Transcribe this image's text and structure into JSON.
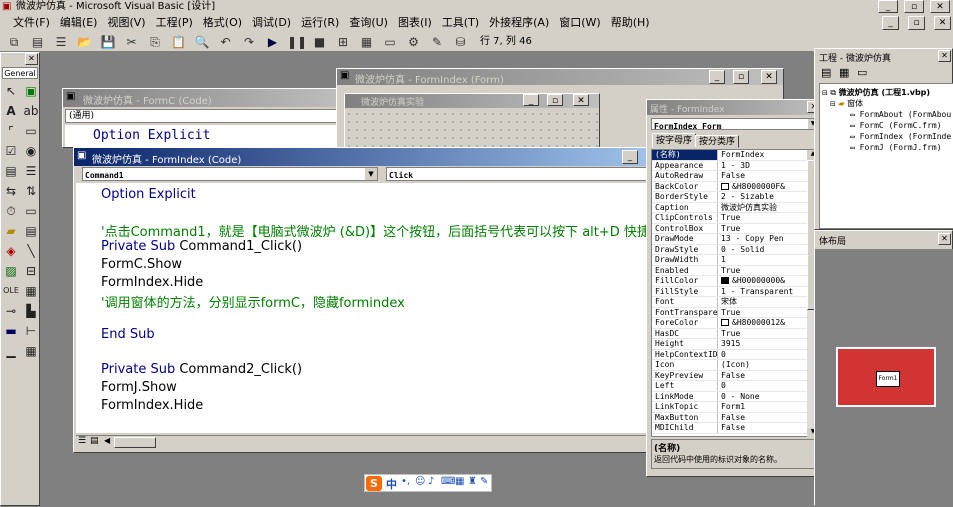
{
  "app_title": "微波炉仿真 - Microsoft Visual Basic [设计]",
  "menu": [
    "文件(F)",
    "编辑(E)",
    "视图(V)",
    "工程(P)",
    "格式(O)",
    "调试(D)",
    "运行(R)",
    "查询(U)",
    "图表(I)",
    "工具(T)",
    "外接程序(A)",
    "窗口(W)",
    "帮助(H)"
  ],
  "toolbar": {
    "position": "行 7, 列 46"
  },
  "toolbox": {
    "title": "General"
  },
  "windows": {
    "formc_code": {
      "title": "微波炉仿真 - FormC (Code)",
      "combo": "(通用)",
      "code_line": "Option Explicit"
    },
    "formindex_form": {
      "title": "微波炉仿真 - FormIndex (Form)"
    },
    "designer_inner": {
      "title": "微波炉仿真实验"
    },
    "formindex_code": {
      "title": "微波炉仿真 - FormIndex (Code)",
      "object_combo": "Command1",
      "proc_combo": "Click",
      "lines": [
        "Option Explicit",
        "",
        "'点击Command1，就是【电脑式微波炉 (&D)】这个按钮，后面括号代表可以按下 alt+D 快捷",
        "Private Sub Command1_Click()",
        "FormC.Show",
        "FormIndex.Hide",
        "'调用窗体的方法，分别显示formC，隐藏formindex",
        "",
        "End Sub",
        "",
        "Private Sub Command2_Click()",
        "FormJ.Show",
        "FormIndex.Hide"
      ]
    }
  },
  "properties": {
    "title": "属性 - FormIndex",
    "object": "FormIndex Form",
    "tabs": [
      "按字母序",
      "按分类序"
    ],
    "rows": [
      [
        "(名称)",
        "FormIndex"
      ],
      [
        "Appearance",
        "1 - 3D"
      ],
      [
        "AutoRedraw",
        "False"
      ],
      [
        "BackColor",
        "&H8000000F&"
      ],
      [
        "BorderStyle",
        "2 - Sizable"
      ],
      [
        "Caption",
        "微波炉仿真实验"
      ],
      [
        "ClipControls",
        "True"
      ],
      [
        "ControlBox",
        "True"
      ],
      [
        "DrawMode",
        "13 - Copy Pen"
      ],
      [
        "DrawStyle",
        "0 - Solid"
      ],
      [
        "DrawWidth",
        "1"
      ],
      [
        "Enabled",
        "True"
      ],
      [
        "FillColor",
        "&H00000000&"
      ],
      [
        "FillStyle",
        "1 - Transparent"
      ],
      [
        "Font",
        "宋体"
      ],
      [
        "FontTransparent",
        "True"
      ],
      [
        "ForeColor",
        "&H80000012&"
      ],
      [
        "HasDC",
        "True"
      ],
      [
        "Height",
        "3915"
      ],
      [
        "HelpContextID",
        "0"
      ],
      [
        "Icon",
        "(Icon)"
      ],
      [
        "KeyPreview",
        "False"
      ],
      [
        "Left",
        "0"
      ],
      [
        "LinkMode",
        "0 - None"
      ],
      [
        "LinkTopic",
        "Form1"
      ],
      [
        "MaxButton",
        "False"
      ],
      [
        "MDIChild",
        "False"
      ]
    ],
    "desc_title": "(名称)",
    "desc_text": "返回代码中使用的标识对象的名称。"
  },
  "project": {
    "title": "工程 - 微波炉仿真",
    "root": "微波炉仿真 (工程1.vbp)",
    "folder": "窗体",
    "forms": [
      "FormAbout (FormAbou",
      "FormC (FormC.frm)",
      "FormIndex (FormInde",
      "FormJ (FormJ.frm)"
    ]
  },
  "layout_window": {
    "title": "体布局",
    "form_label": "Form1"
  },
  "ime_bar": {
    "mode": "中"
  }
}
